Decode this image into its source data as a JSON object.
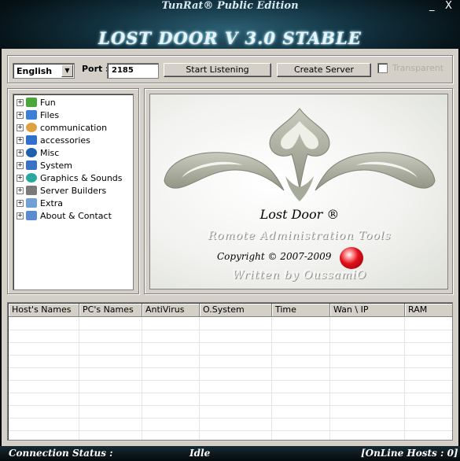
{
  "window": {
    "edition": "TunRat® Public Edition",
    "title": "LOST DOOR V 3.0  STABLE",
    "minimize": "_",
    "close": "X"
  },
  "toolbar": {
    "language": "English",
    "port_label": "Port :",
    "port_value": "2185",
    "start_listening": "Start  Listening",
    "create_server": "Create Server",
    "transparent_label": "Transparent",
    "transparent_checked": false
  },
  "tree": {
    "items": [
      {
        "label": "Fun",
        "icon": "folder-smiley-icon",
        "color": "#4aa83a"
      },
      {
        "label": "Files",
        "icon": "files-icon",
        "color": "#3b7fd6"
      },
      {
        "label": "communication",
        "icon": "person-icon",
        "color": "#e0a040"
      },
      {
        "label": "accessories",
        "icon": "cube-icon",
        "color": "#2f6fd0"
      },
      {
        "label": "Misc",
        "icon": "gear-globe-icon",
        "color": "#1f5fb0"
      },
      {
        "label": "System",
        "icon": "monitor-icon",
        "color": "#3a72c8"
      },
      {
        "label": "Graphics & Sounds",
        "icon": "palette-icon",
        "color": "#2aa8a0"
      },
      {
        "label": "Server Builders",
        "icon": "tools-icon",
        "color": "#7a7a7a"
      },
      {
        "label": "Extra",
        "icon": "extra-icon",
        "color": "#6fa0d8"
      },
      {
        "label": "About & Contact",
        "icon": "book-icon",
        "color": "#5a8ad0"
      }
    ]
  },
  "splash": {
    "title": "Lost Door ®",
    "subtitle": "Romote Administration Tools",
    "copyright": "Copyright © 2007-2009",
    "author": "Written by OussamiO"
  },
  "table": {
    "columns": [
      "Host's Names",
      "PC's Names",
      "AntiVirus",
      "O.System",
      "Time",
      "Wan \\ IP",
      "RAM"
    ],
    "rows": []
  },
  "status": {
    "connection_label": "Connection Status :",
    "connection_value": "Idle",
    "online_hosts": "[OnLine Hosts : 0]"
  }
}
